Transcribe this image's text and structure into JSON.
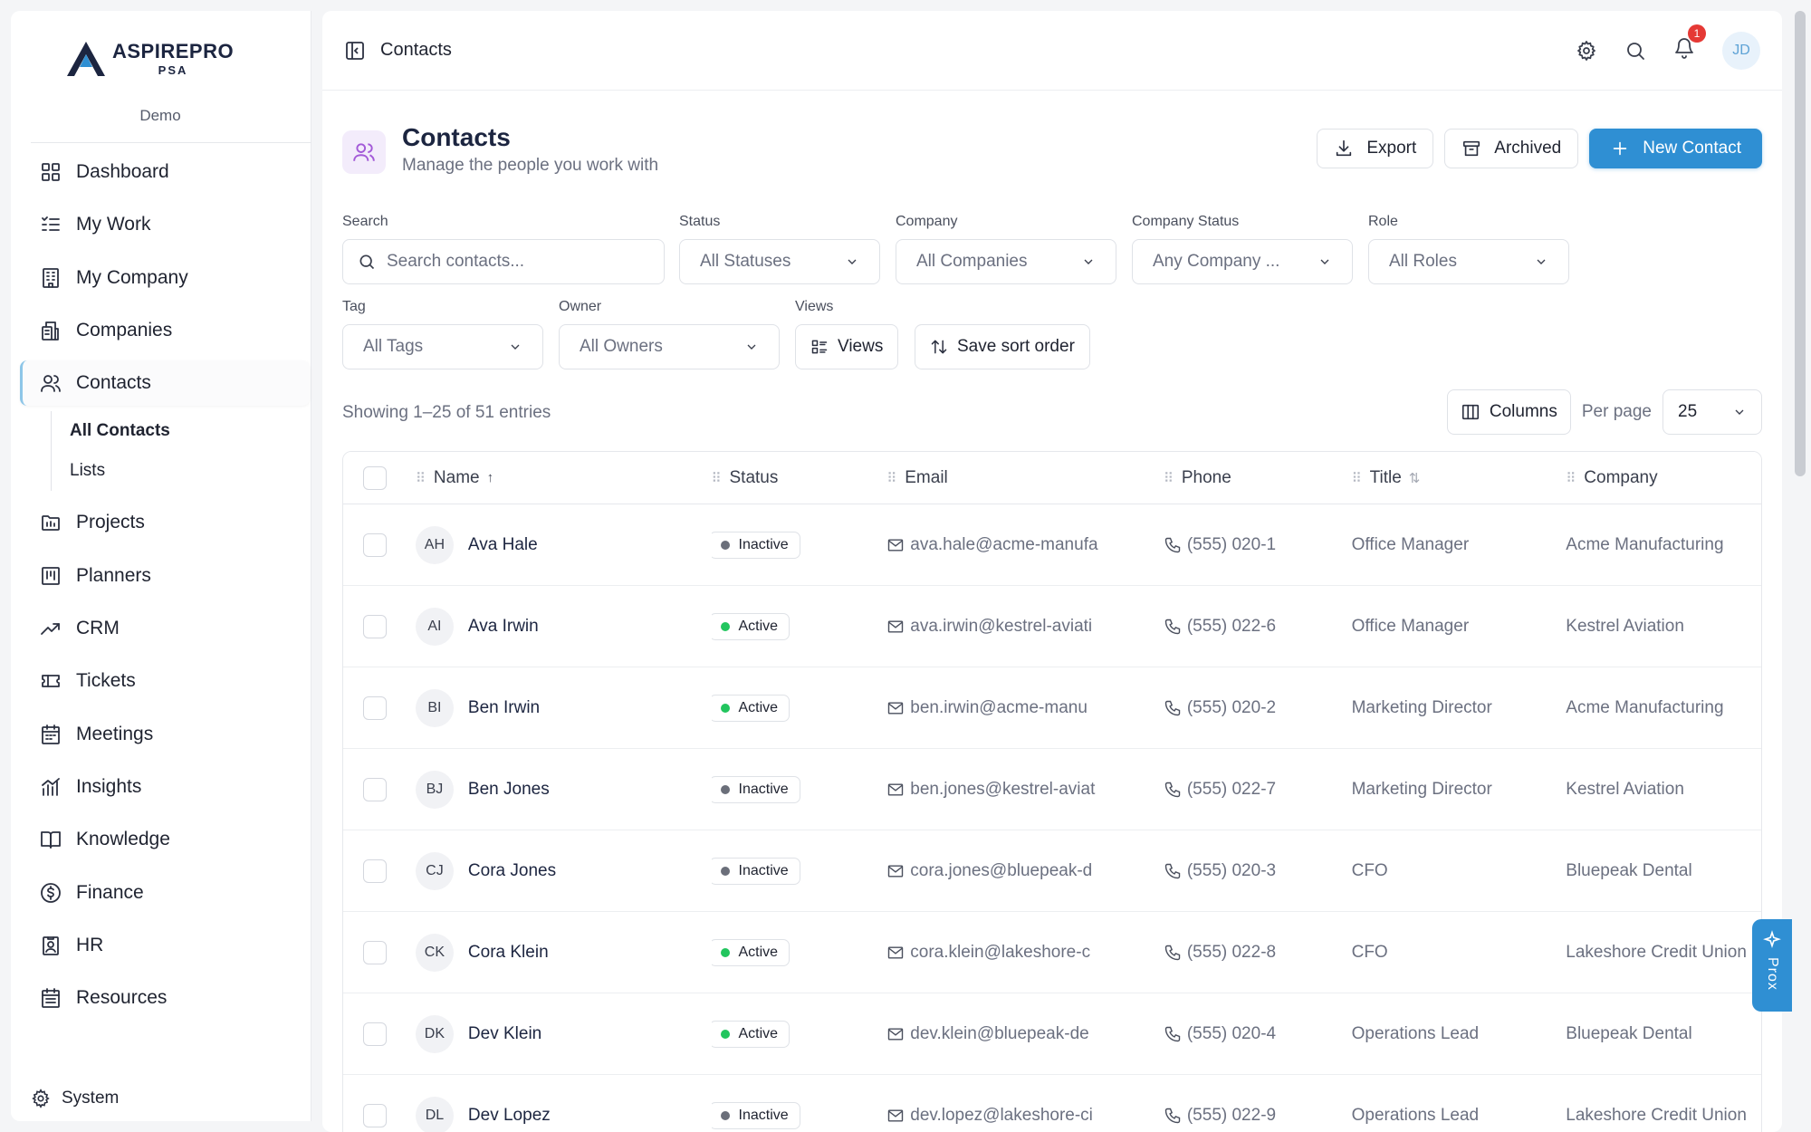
{
  "sidebar": {
    "brand": "ASPIREPRO",
    "brand_sub": "PSA",
    "tenant": "Demo",
    "items": [
      {
        "label": "Dashboard",
        "icon": "grid-icon"
      },
      {
        "label": "My Work",
        "icon": "list-check-icon"
      },
      {
        "label": "My Company",
        "icon": "building-icon"
      },
      {
        "label": "Companies",
        "icon": "buildings-icon"
      },
      {
        "label": "Contacts",
        "icon": "users-icon",
        "active": true
      },
      {
        "label": "Projects",
        "icon": "folder-icon"
      },
      {
        "label": "Planners",
        "icon": "kanban-icon"
      },
      {
        "label": "CRM",
        "icon": "trending-up-icon"
      },
      {
        "label": "Tickets",
        "icon": "ticket-icon"
      },
      {
        "label": "Meetings",
        "icon": "calendar-icon"
      },
      {
        "label": "Insights",
        "icon": "bar-chart-icon"
      },
      {
        "label": "Knowledge",
        "icon": "book-icon"
      },
      {
        "label": "Finance",
        "icon": "dollar-icon"
      },
      {
        "label": "HR",
        "icon": "id-badge-icon"
      },
      {
        "label": "Resources",
        "icon": "calendar-grid-icon"
      }
    ],
    "contacts_sub": [
      "All Contacts",
      "Lists"
    ],
    "system_label": "System"
  },
  "topbar": {
    "breadcrumb": "Contacts",
    "notifications_count": "1",
    "avatar_initials": "JD"
  },
  "page": {
    "title": "Contacts",
    "subtitle": "Manage the people you work with",
    "export_label": "Export",
    "archived_label": "Archived",
    "new_label": "New Contact"
  },
  "filters": {
    "search_label": "Search",
    "search_placeholder": "Search contacts...",
    "status_label": "Status",
    "status_value": "All Statuses",
    "company_label": "Company",
    "company_value": "All Companies",
    "company_status_label": "Company Status",
    "company_status_value": "Any Company ...",
    "role_label": "Role",
    "role_value": "All Roles",
    "tag_label": "Tag",
    "tag_value": "All Tags",
    "owner_label": "Owner",
    "owner_value": "All Owners",
    "views_label": "Views",
    "views_button": "Views",
    "save_sort_label": "Save sort order"
  },
  "table_meta": {
    "entries": "Showing 1–25 of 51 entries",
    "columns_label": "Columns",
    "per_page_label": "Per page",
    "per_page_value": "25"
  },
  "table": {
    "headers": [
      "Name",
      "Status",
      "Email",
      "Phone",
      "Title",
      "Company"
    ],
    "rows": [
      {
        "initials": "AH",
        "name": "Ava Hale",
        "status": "Inactive",
        "email": "ava.hale@acme-manufa",
        "phone": "(555) 020-1",
        "title": "Office Manager",
        "company": "Acme Manufacturing"
      },
      {
        "initials": "AI",
        "name": "Ava Irwin",
        "status": "Active",
        "email": "ava.irwin@kestrel-aviati",
        "phone": "(555) 022-6",
        "title": "Office Manager",
        "company": "Kestrel Aviation"
      },
      {
        "initials": "BI",
        "name": "Ben Irwin",
        "status": "Active",
        "email": "ben.irwin@acme-manu",
        "phone": "(555) 020-2",
        "title": "Marketing Director",
        "company": "Acme Manufacturing"
      },
      {
        "initials": "BJ",
        "name": "Ben Jones",
        "status": "Inactive",
        "email": "ben.jones@kestrel-aviat",
        "phone": "(555) 022-7",
        "title": "Marketing Director",
        "company": "Kestrel Aviation"
      },
      {
        "initials": "CJ",
        "name": "Cora Jones",
        "status": "Inactive",
        "email": "cora.jones@bluepeak-d",
        "phone": "(555) 020-3",
        "title": "CFO",
        "company": "Bluepeak Dental"
      },
      {
        "initials": "CK",
        "name": "Cora Klein",
        "status": "Active",
        "email": "cora.klein@lakeshore-c",
        "phone": "(555) 022-8",
        "title": "CFO",
        "company": "Lakeshore Credit Union"
      },
      {
        "initials": "DK",
        "name": "Dev Klein",
        "status": "Active",
        "email": "dev.klein@bluepeak-de",
        "phone": "(555) 020-4",
        "title": "Operations Lead",
        "company": "Bluepeak Dental"
      },
      {
        "initials": "DL",
        "name": "Dev Lopez",
        "status": "Inactive",
        "email": "dev.lopez@lakeshore-ci",
        "phone": "(555) 022-9",
        "title": "Operations Lead",
        "company": "Lakeshore Credit Union"
      }
    ]
  },
  "assistant": {
    "label": "Prox"
  },
  "colors": {
    "accent": "#2f8fd3",
    "active": "#22c55e",
    "inactive": "#6b6f7a",
    "badge": "#e53935"
  }
}
